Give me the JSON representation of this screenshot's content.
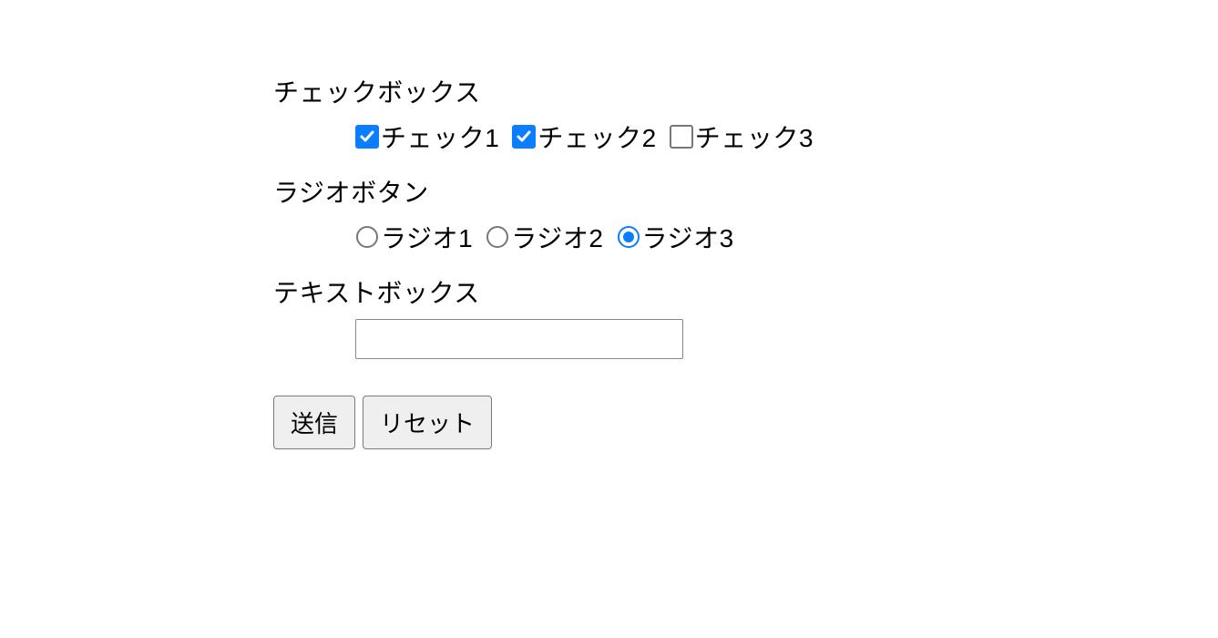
{
  "checkbox": {
    "title": "チェックボックス",
    "items": [
      {
        "label": "チェック1",
        "checked": true
      },
      {
        "label": "チェック2",
        "checked": true
      },
      {
        "label": "チェック3",
        "checked": false
      }
    ]
  },
  "radio": {
    "title": "ラジオボタン",
    "items": [
      {
        "label": "ラジオ1",
        "selected": false
      },
      {
        "label": "ラジオ2",
        "selected": false
      },
      {
        "label": "ラジオ3",
        "selected": true
      }
    ]
  },
  "textbox": {
    "title": "テキストボックス",
    "value": ""
  },
  "buttons": {
    "submit": "送信",
    "reset": "リセット"
  },
  "colors": {
    "accent": "#0a7eff",
    "border": "#7a7a7a"
  }
}
